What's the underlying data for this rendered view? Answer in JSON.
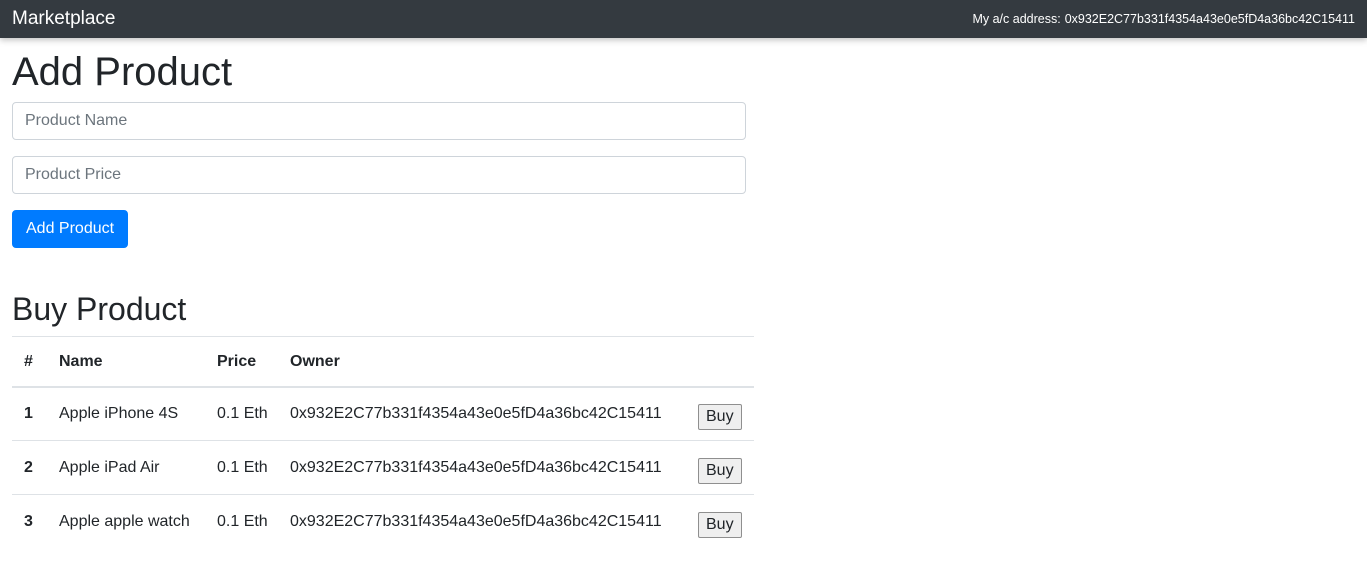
{
  "navbar": {
    "brand": "Marketplace",
    "account_label": "My a/c address:",
    "account_address": "0x932E2C77b331f4354a43e0e5fD4a36bc42C15411"
  },
  "add_product": {
    "title": "Add Product",
    "name_placeholder": "Product Name",
    "price_placeholder": "Product Price",
    "submit_label": "Add Product"
  },
  "buy_product": {
    "title": "Buy Product",
    "columns": [
      "#",
      "Name",
      "Price",
      "Owner"
    ],
    "rows": [
      {
        "id": "1",
        "name": "Apple iPhone 4S",
        "price": "0.1 Eth",
        "owner": "0x932E2C77b331f4354a43e0e5fD4a36bc42C15411",
        "action": "Buy"
      },
      {
        "id": "2",
        "name": "Apple iPad Air",
        "price": "0.1 Eth",
        "owner": "0x932E2C77b331f4354a43e0e5fD4a36bc42C15411",
        "action": "Buy"
      },
      {
        "id": "3",
        "name": "Apple apple watch",
        "price": "0.1 Eth",
        "owner": "0x932E2C77b331f4354a43e0e5fD4a36bc42C15411",
        "action": "Buy"
      }
    ]
  },
  "colors": {
    "navbar_bg": "#343a40",
    "primary": "#007bff"
  }
}
